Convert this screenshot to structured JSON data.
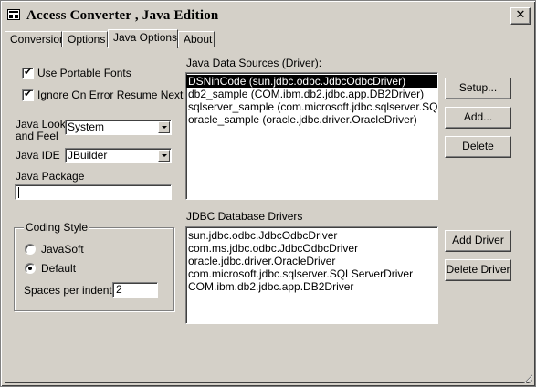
{
  "window": {
    "title": "Access Converter , Java Edition",
    "close_glyph": "✕"
  },
  "tabs": [
    {
      "label": "Conversion",
      "active": false
    },
    {
      "label": "Options",
      "active": false
    },
    {
      "label": "Java Options",
      "active": true
    },
    {
      "label": "About",
      "active": false
    }
  ],
  "options": {
    "use_portable_fonts": {
      "label": "Use Portable Fonts",
      "checked": true
    },
    "ignore_on_error": {
      "label": "Ignore On Error Resume Next",
      "checked": true
    },
    "look_and_feel": {
      "label": "Java Look and Feel",
      "value": "System"
    },
    "java_ide": {
      "label": "Java IDE",
      "value": "JBuilder"
    },
    "java_package": {
      "label": "Java Package",
      "value": ""
    }
  },
  "coding_style": {
    "title": "Coding Style",
    "javasoft_label": "JavaSoft",
    "default_label": "Default",
    "selected": "Default",
    "spaces_label": "Spaces per indent:",
    "spaces_value": "2"
  },
  "data_sources": {
    "label": "Java Data Sources (Driver):",
    "items": [
      "DSNinCode (sun.jdbc.odbc.JdbcOdbcDriver)",
      "db2_sample (COM.ibm.db2.jdbc.app.DB2Driver)",
      "sqlserver_sample (com.microsoft.jdbc.sqlserver.SQLServerDriver)",
      "oracle_sample (oracle.jdbc.driver.OracleDriver)"
    ],
    "selected_index": 0,
    "buttons": {
      "setup": "Setup...",
      "add": "Add...",
      "delete": "Delete"
    }
  },
  "jdbc_drivers": {
    "label": "JDBC Database Drivers",
    "items": [
      "sun.jdbc.odbc.JdbcOdbcDriver",
      "com.ms.jdbc.odbc.JdbcOdbcDriver",
      "oracle.jdbc.driver.OracleDriver",
      "com.microsoft.jdbc.sqlserver.SQLServerDriver",
      "COM.ibm.db2.jdbc.app.DB2Driver"
    ],
    "buttons": {
      "add_driver": "Add Driver",
      "delete_driver": "Delete Driver"
    }
  }
}
